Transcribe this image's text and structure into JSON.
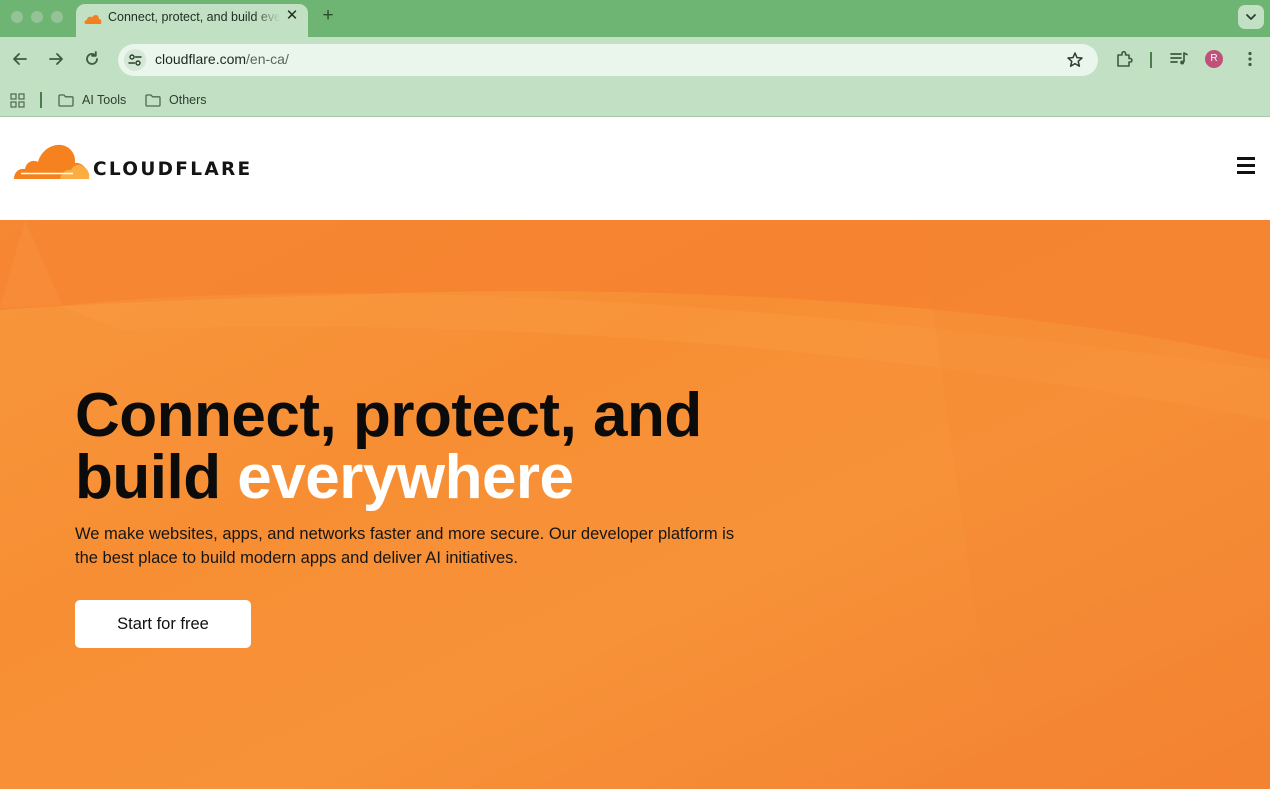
{
  "browser": {
    "tab": {
      "title": "Connect, protect, and build everywhere",
      "close_glyph": "✕"
    },
    "new_tab_glyph": "+",
    "address_bar": {
      "host": "cloudflare.com",
      "path": "/en-ca/"
    },
    "profile_initial": "R",
    "bookmarks": [
      {
        "label": "AI Tools",
        "icon": "folder-icon"
      },
      {
        "label": "Others",
        "icon": "folder-icon"
      }
    ],
    "icons": [
      "back-arrow-icon",
      "forward-arrow-icon",
      "reload-icon",
      "site-info-icon",
      "star-icon",
      "extensions-icon",
      "media-controls-icon",
      "more-vert-icon",
      "apps-grid-icon",
      "chevron-down-icon"
    ]
  },
  "site": {
    "logo_text": "CLOUDFLARE",
    "menu_glyph": "☰"
  },
  "hero": {
    "title_line1": "Connect, protect, and",
    "title_line2_plain": "build ",
    "title_line2_accent": "everywhere",
    "subtitle": "We make websites, apps, and networks faster and more secure. Our developer platform is the best place to build modern apps and deliver AI initiatives.",
    "cta_label": "Start for free"
  },
  "colors": {
    "browser_frame": "#6eb472",
    "browser_toolbar": "#c2e0c4",
    "brand_orange": "#f38020",
    "hero_background": "#f78e34",
    "hero_accent_text": "#ffffff",
    "avatar": "#c0527a"
  }
}
